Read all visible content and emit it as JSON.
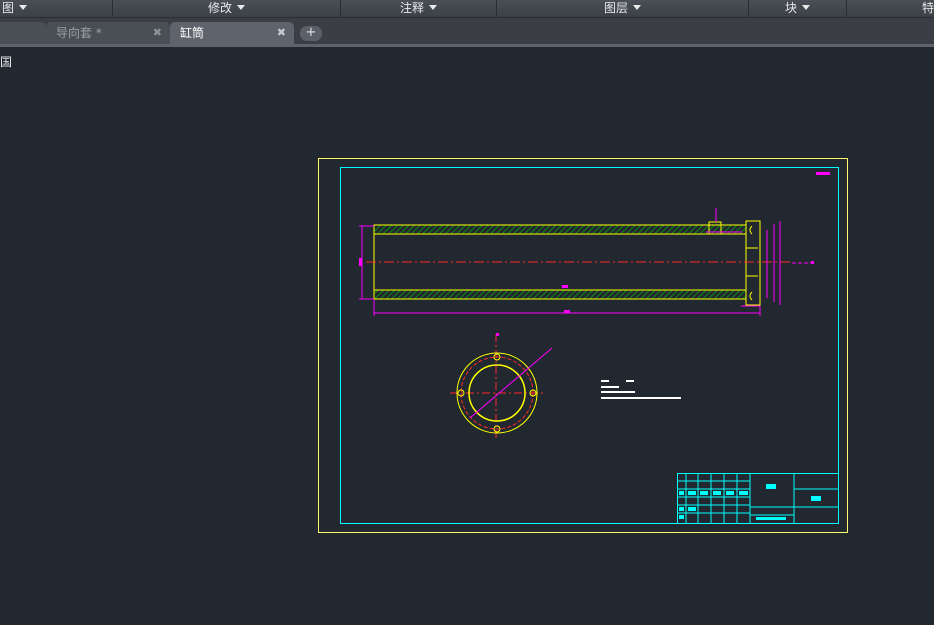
{
  "ribbon": {
    "panels": [
      "图",
      "修改",
      "注释",
      "图层",
      "块",
      "特"
    ]
  },
  "tabs": {
    "items": [
      {
        "label": ""
      },
      {
        "label": "导向套 *"
      },
      {
        "label": "缸筒"
      }
    ],
    "close_glyph": "✖",
    "add_glyph": "+"
  },
  "viewport": {
    "label": "国"
  },
  "drawing": {
    "colors": {
      "background": "#212830",
      "border": "#ffff6e",
      "inner_frame": "#00ffff",
      "section": "#ffff00",
      "hatch": "#00c800",
      "centerline": "#ff2a2a",
      "dimension": "#ff00ff"
    }
  }
}
